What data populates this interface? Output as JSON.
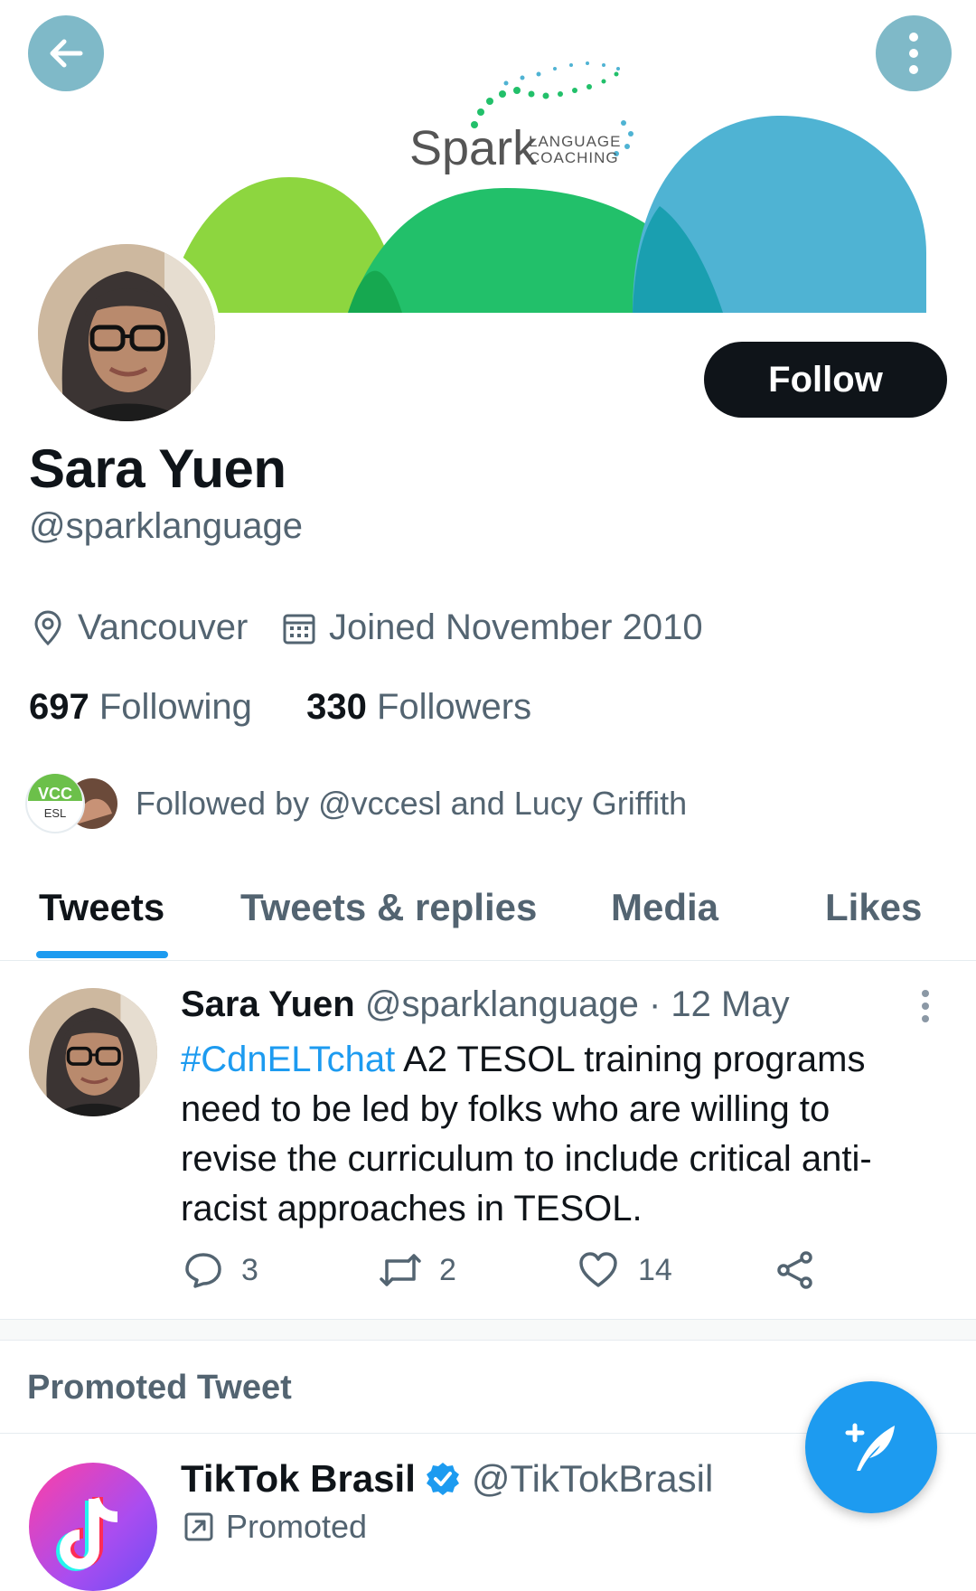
{
  "banner": {
    "logo_word": "Spark",
    "logo_line1": "LANGUAGE",
    "logo_line2": "COACHING"
  },
  "profile": {
    "name": "Sara Yuen",
    "handle": "@sparklanguage",
    "location": "Vancouver",
    "joined": "Joined November 2010",
    "following_count": "697",
    "following_label": "Following",
    "followers_count": "330",
    "followers_label": "Followers",
    "followed_by": "Followed by @vccesl and Lucy Griffith",
    "follow_button": "Follow",
    "vcc_badge_top": "VCC",
    "vcc_badge_bottom": "ESL"
  },
  "tabs": [
    {
      "label": "Tweets",
      "active": true
    },
    {
      "label": "Tweets & replies",
      "active": false
    },
    {
      "label": "Media",
      "active": false
    },
    {
      "label": "Likes",
      "active": false
    }
  ],
  "tweet": {
    "author": "Sara Yuen",
    "handle_date": "@sparklanguage · 12 May",
    "hashtag": "#CdnELTchat",
    "text": " A2 TESOL training programs need to be led by folks who are willing to revise the curriculum to include critical anti-racist approaches in TESOL.",
    "replies": "3",
    "retweets": "2",
    "likes": "14"
  },
  "promoted": {
    "section_title": "Promoted Tweet",
    "author": "TikTok Brasil",
    "handle": "@TikTokBrasil",
    "label": "Promoted"
  },
  "colors": {
    "accent": "#1d9bf0",
    "text": "#0f1419",
    "muted": "#536471",
    "banner_green_light": "#8dd63f",
    "banner_green": "#22c06a",
    "banner_blue": "#4fb3d3"
  },
  "icons": [
    "back-arrow-icon",
    "more-vertical-icon",
    "location-pin-icon",
    "calendar-icon",
    "reply-icon",
    "retweet-icon",
    "like-icon",
    "share-icon",
    "verified-icon",
    "promoted-arrow-icon",
    "compose-tweet-icon"
  ]
}
